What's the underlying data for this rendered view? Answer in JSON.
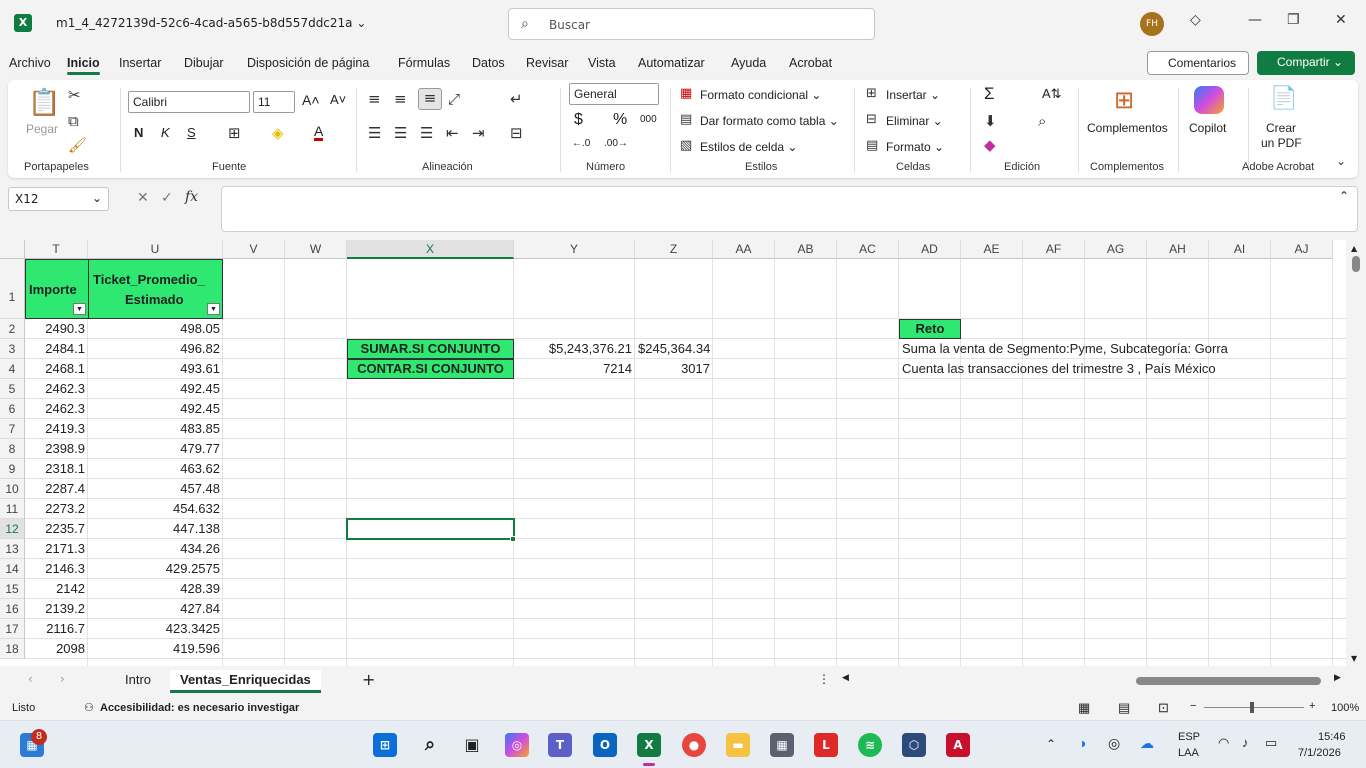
{
  "title_bar": {
    "doc_name": "m1_4_4272139d-52c6-4cad-a565-b8d557ddc21a",
    "search_placeholder": "Buscar",
    "avatar_initials": "FH"
  },
  "menu": {
    "tabs": [
      "Archivo",
      "Inicio",
      "Insertar",
      "Dibujar",
      "Disposición de página",
      "Fórmulas",
      "Datos",
      "Revisar",
      "Vista",
      "Automatizar",
      "Ayuda",
      "Acrobat"
    ],
    "active": "Inicio",
    "comments_label": "Comentarios",
    "share_label": "Compartir"
  },
  "ribbon": {
    "groups": {
      "clipboard": "Portapapeles",
      "font": "Fuente",
      "alignment": "Alineación",
      "number": "Número",
      "styles": "Estilos",
      "cells": "Celdas",
      "editing": "Edición",
      "addins": "Complementos",
      "acrobat": "Adobe Acrobat"
    },
    "paste_label": "Pegar",
    "font_name": "Calibri",
    "font_size": "11",
    "bold": "N",
    "italic": "K",
    "underline": "S",
    "number_format": "General",
    "conditional_format": "Formato condicional",
    "format_as_table": "Dar formato como tabla",
    "cell_styles": "Estilos de celda",
    "insert": "Insertar",
    "delete": "Eliminar",
    "format": "Formato",
    "addins_button": "Complementos",
    "copilot": "Copilot",
    "create_pdf_line1": "Crear",
    "create_pdf_line2": "un PDF"
  },
  "formula_bar": {
    "name_box": "X12",
    "fx": "fx",
    "content": ""
  },
  "grid": {
    "columns": [
      "T",
      "U",
      "V",
      "W",
      "X",
      "Y",
      "Z",
      "AA",
      "AB",
      "AC",
      "AD",
      "AE",
      "AF",
      "AG",
      "AH",
      "AI",
      "AJ"
    ],
    "selected_column": "X",
    "selected_row": "12",
    "rows": [
      "1",
      "2",
      "3",
      "4",
      "5",
      "6",
      "7",
      "8",
      "9",
      "10",
      "11",
      "12",
      "13",
      "14",
      "15",
      "16",
      "17",
      "18"
    ],
    "header_t": "Importe",
    "header_u_line1": "Ticket_Promedio_",
    "header_u_line2": "Estimado",
    "importe": [
      "2490.3",
      "2484.1",
      "2468.1",
      "2462.3",
      "2462.3",
      "2419.3",
      "2398.9",
      "2318.1",
      "2287.4",
      "2273.2",
      "2235.7",
      "2171.3",
      "2146.3",
      "2142",
      "2139.2",
      "2116.7",
      "2098"
    ],
    "ticket": [
      "498.05",
      "496.82",
      "493.61",
      "492.45",
      "492.45",
      "483.85",
      "479.77",
      "463.62",
      "457.48",
      "454.632",
      "447.138",
      "434.26",
      "429.2575",
      "428.39",
      "427.84",
      "423.3425",
      "419.596"
    ],
    "sumar_label": "SUMAR.SI CONJUNTO",
    "contar_label": "CONTAR.SI CONJUNTO",
    "sumar_y": "$5,243,376.21",
    "sumar_z": "$245,364.34",
    "contar_y": "7214",
    "contar_z": "3017",
    "reto_label": "Reto",
    "reto_1": "Suma la venta de Segmento:Pyme, Subcategoría: Gorra",
    "reto_2": "Cuenta las transacciones del trimestre 3 , País México"
  },
  "sheets": {
    "tabs": [
      "Intro",
      "Ventas_Enriquecidas"
    ],
    "active": "Ventas_Enriquecidas",
    "add": "+"
  },
  "status": {
    "ready": "Listo",
    "accessibility": "Accesibilidad: es necesario investigar",
    "zoom": "100%"
  },
  "taskbar": {
    "notifications": "8",
    "lang1": "ESP",
    "lang2": "LAA",
    "time": "15:46",
    "date": "7/1/2026"
  },
  "colors": {
    "accent": "#107c41",
    "green_header": "#2ee872"
  }
}
